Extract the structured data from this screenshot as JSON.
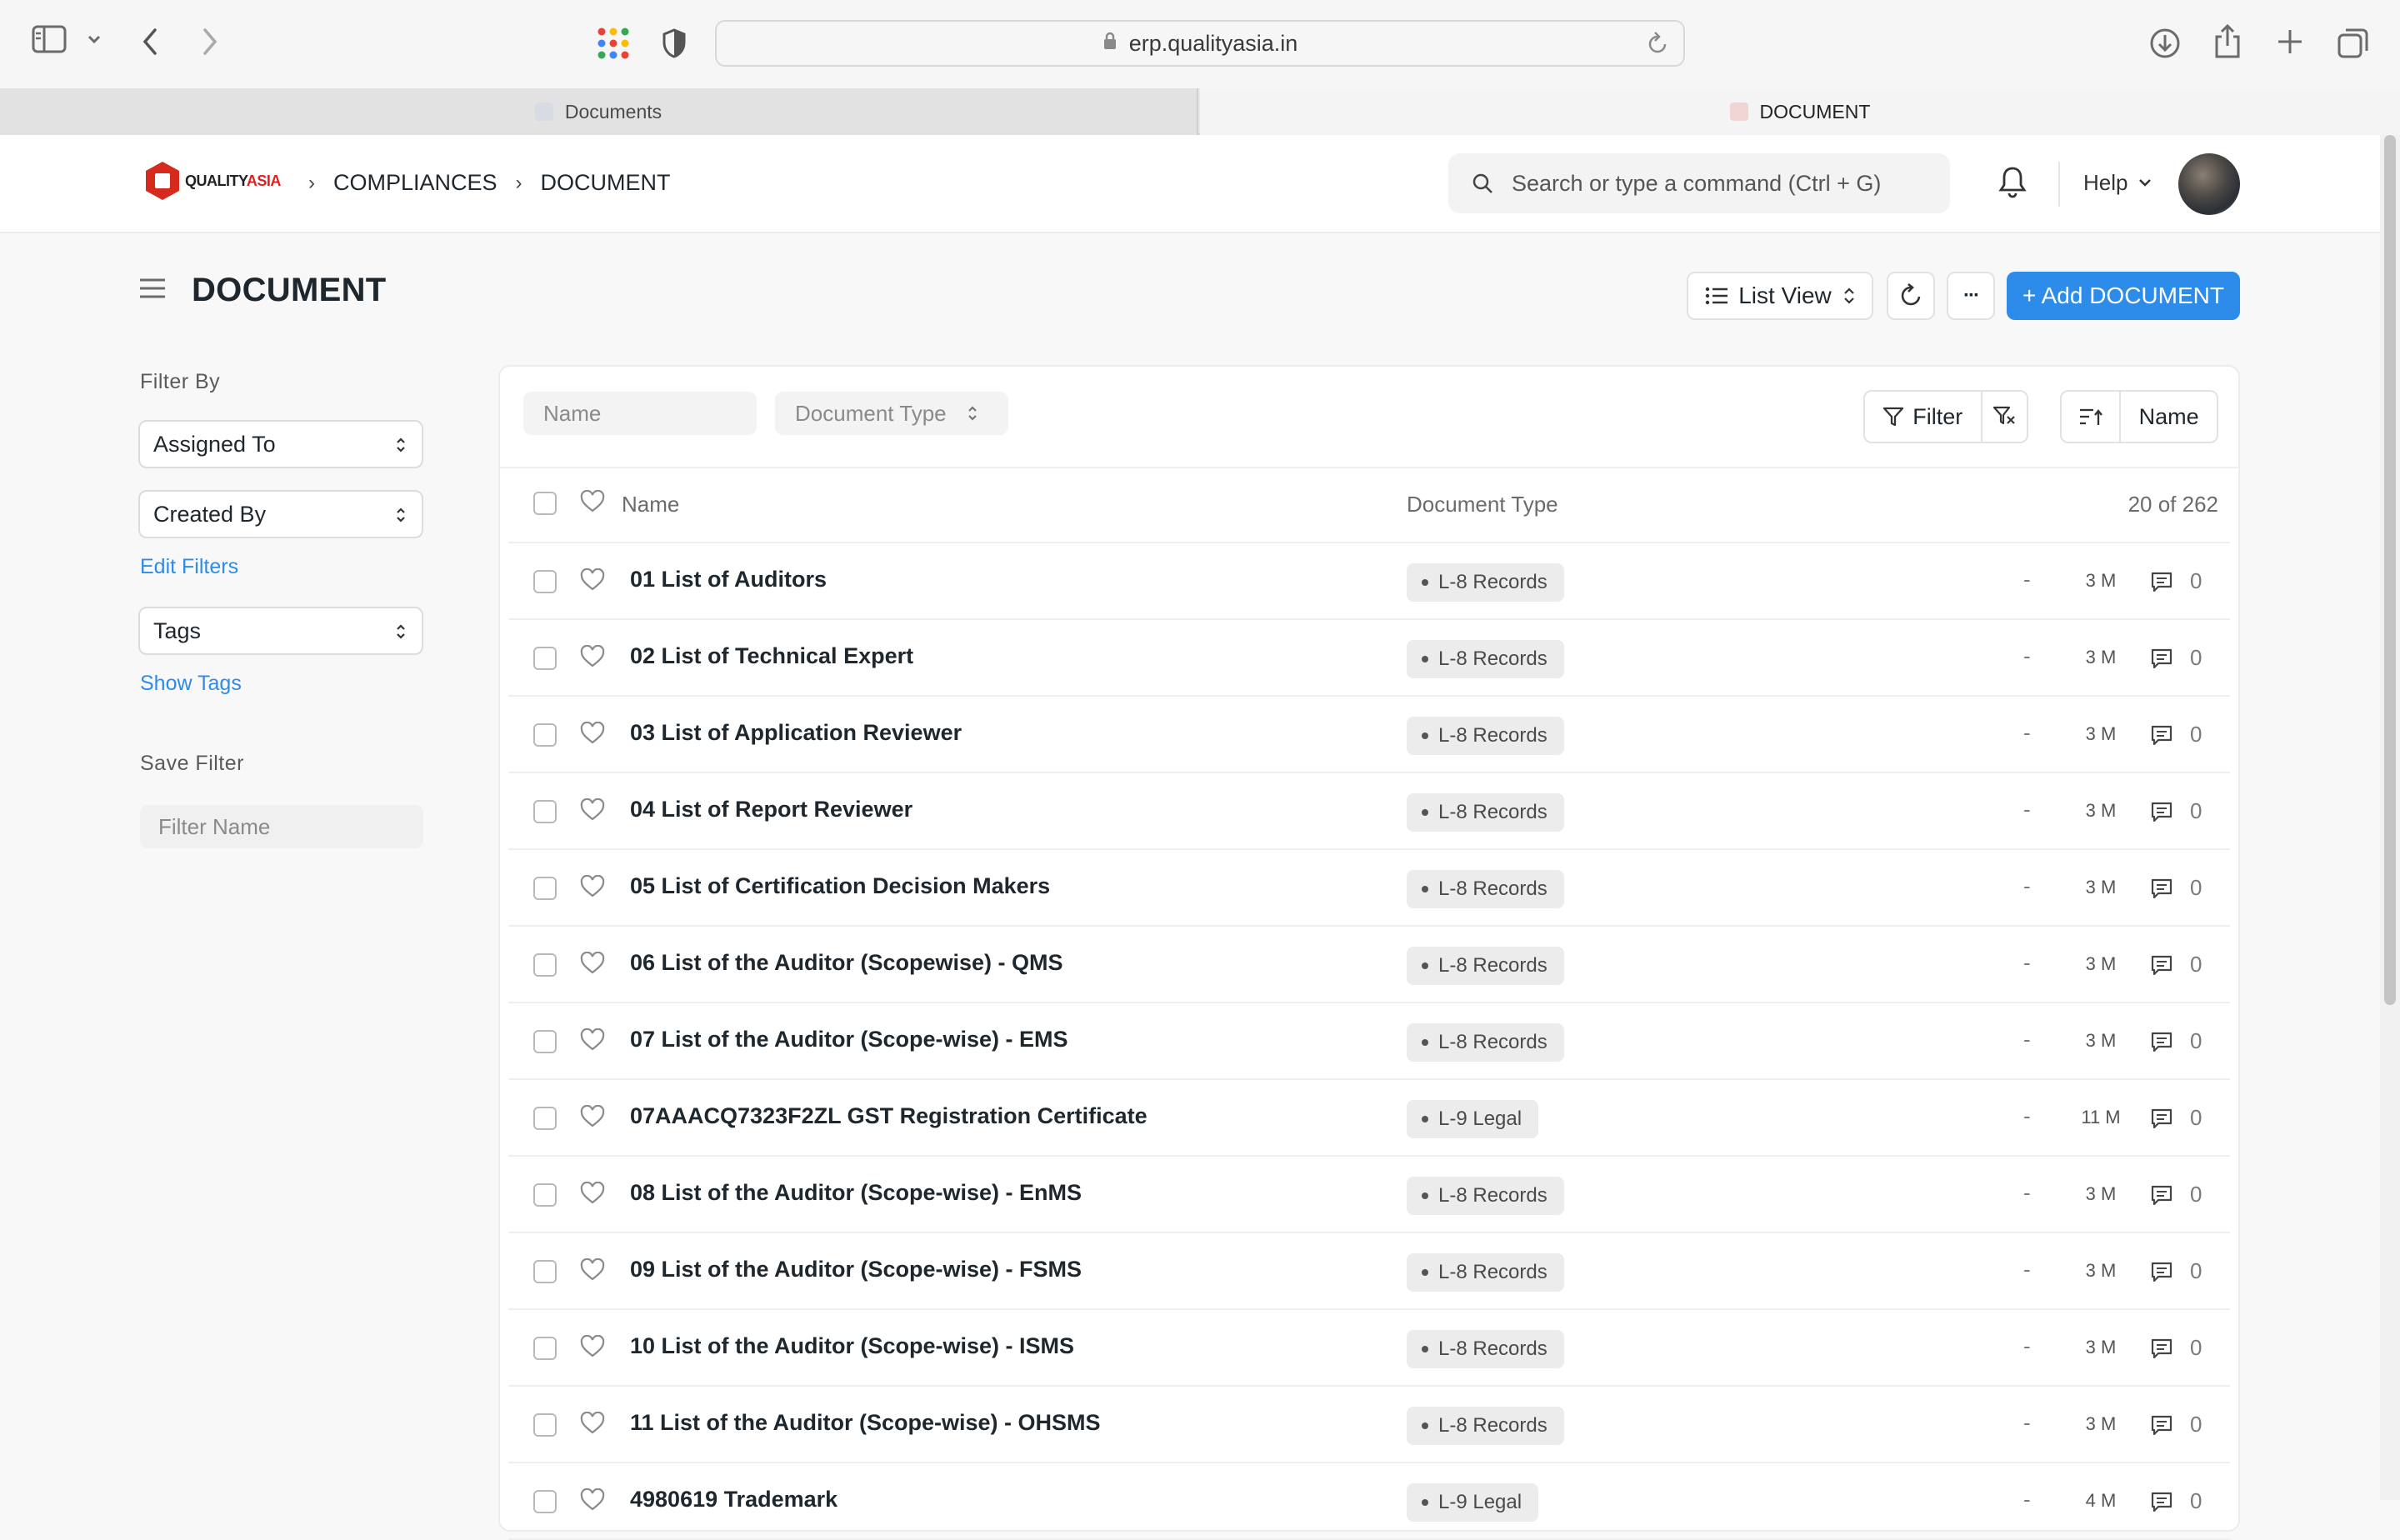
{
  "browser": {
    "url": "erp.qualityasia.in",
    "tabs": [
      {
        "label": "Documents"
      },
      {
        "label": "DOCUMENT"
      }
    ]
  },
  "navbar": {
    "logo_text_a": "QUALITY",
    "logo_text_b": "ASIA",
    "breadcrumbs": [
      "COMPLIANCES",
      "DOCUMENT"
    ],
    "search_placeholder": "Search or type a command (Ctrl + G)",
    "help_label": "Help"
  },
  "page": {
    "title": "DOCUMENT",
    "view_label": "List View",
    "more_label": "···",
    "add_label": "+ Add DOCUMENT"
  },
  "sidebar": {
    "filter_by": "Filter By",
    "assigned_to": "Assigned To",
    "created_by": "Created By",
    "edit_filters": "Edit Filters",
    "tags": "Tags",
    "show_tags": "Show Tags",
    "save_filter": "Save Filter",
    "filter_name_placeholder": "Filter Name"
  },
  "list": {
    "name_filter_placeholder": "Name",
    "doctype_filter_label": "Document Type",
    "filter_label": "Filter",
    "sort_label": "Name",
    "col_name": "Name",
    "col_doctype": "Document Type",
    "count": "20 of 262",
    "rows": [
      {
        "name": "01 List of Auditors",
        "type": "L-8 Records",
        "dash": "-",
        "age": "3 M",
        "comments": "0"
      },
      {
        "name": "02 List of Technical Expert",
        "type": "L-8 Records",
        "dash": "-",
        "age": "3 M",
        "comments": "0"
      },
      {
        "name": "03 List of Application Reviewer",
        "type": "L-8 Records",
        "dash": "-",
        "age": "3 M",
        "comments": "0"
      },
      {
        "name": "04 List of Report Reviewer",
        "type": "L-8 Records",
        "dash": "-",
        "age": "3 M",
        "comments": "0"
      },
      {
        "name": "05 List of Certification Decision Makers",
        "type": "L-8 Records",
        "dash": "-",
        "age": "3 M",
        "comments": "0"
      },
      {
        "name": "06 List of the Auditor (Scopewise) - QMS",
        "type": "L-8 Records",
        "dash": "-",
        "age": "3 M",
        "comments": "0"
      },
      {
        "name": "07 List of the Auditor (Scope-wise) - EMS",
        "type": "L-8 Records",
        "dash": "-",
        "age": "3 M",
        "comments": "0"
      },
      {
        "name": "07AAACQ7323F2ZL GST Registration Certificate",
        "type": "L-9 Legal",
        "dash": "-",
        "age": "11 M",
        "comments": "0"
      },
      {
        "name": "08 List of the Auditor (Scope-wise) - EnMS",
        "type": "L-8 Records",
        "dash": "-",
        "age": "3 M",
        "comments": "0"
      },
      {
        "name": "09 List of the Auditor (Scope-wise) - FSMS",
        "type": "L-8 Records",
        "dash": "-",
        "age": "3 M",
        "comments": "0"
      },
      {
        "name": "10 List of the Auditor (Scope-wise) - ISMS",
        "type": "L-8 Records",
        "dash": "-",
        "age": "3 M",
        "comments": "0"
      },
      {
        "name": "11 List of the Auditor (Scope-wise) - OHSMS",
        "type": "L-8 Records",
        "dash": "-",
        "age": "3 M",
        "comments": "0"
      },
      {
        "name": "4980619 Trademark",
        "type": "L-9 Legal",
        "dash": "-",
        "age": "4 M",
        "comments": "0"
      }
    ]
  },
  "colors": {
    "primary": "#2d8be9",
    "brand_red": "#e02020"
  }
}
